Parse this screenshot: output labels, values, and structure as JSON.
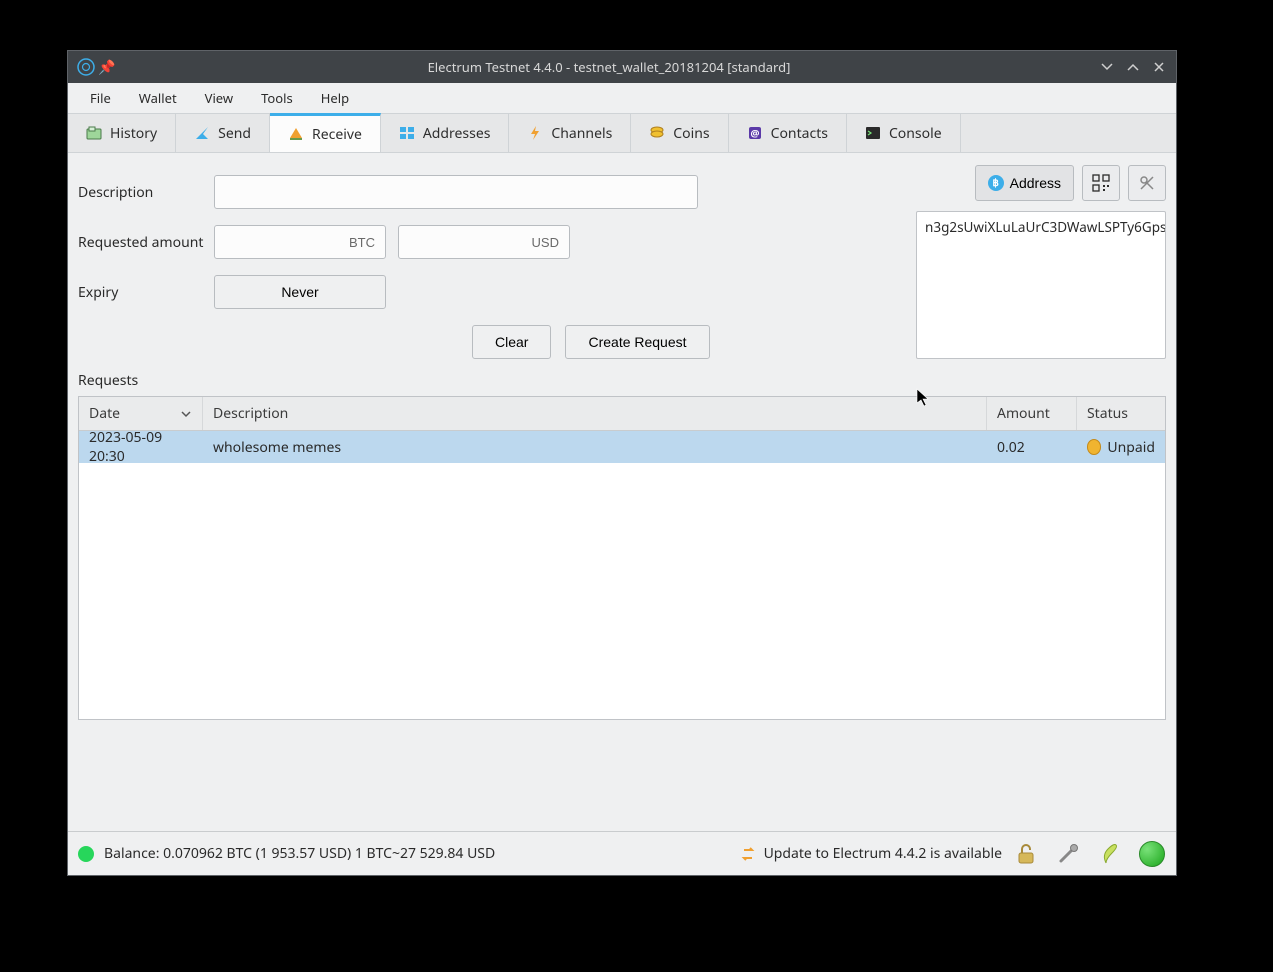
{
  "titlebar": {
    "title": "Electrum Testnet 4.4.0 - testnet_wallet_20181204 [standard]"
  },
  "menu": {
    "file": "File",
    "wallet": "Wallet",
    "view": "View",
    "tools": "Tools",
    "help": "Help"
  },
  "tabs": {
    "history": "History",
    "send": "Send",
    "receive": "Receive",
    "addresses": "Addresses",
    "channels": "Channels",
    "coins": "Coins",
    "contacts": "Contacts",
    "console": "Console"
  },
  "form": {
    "description_label": "Description",
    "description_value": "",
    "requested_label": "Requested amount",
    "btc_placeholder": "BTC",
    "usd_placeholder": "USD",
    "btc_value": "",
    "usd_value": "",
    "expiry_label": "Expiry",
    "expiry_value": "Never",
    "clear_label": "Clear",
    "create_label": "Create Request"
  },
  "right": {
    "address_button": "Address",
    "address_text": "n3g2sUwiXLuLaUrC3DWawLSPTy6Gps"
  },
  "requests": {
    "heading": "Requests",
    "cols": {
      "date": "Date",
      "description": "Description",
      "amount": "Amount",
      "status": "Status"
    },
    "rows": [
      {
        "date": "2023-05-09 20:30",
        "description": "wholesome memes",
        "amount": "0.02",
        "status": "Unpaid"
      }
    ]
  },
  "statusbar": {
    "balance": "Balance: 0.070962 BTC (1 953.57 USD)  1 BTC~27 529.84 USD",
    "update": "Update to Electrum 4.4.2 is available"
  }
}
